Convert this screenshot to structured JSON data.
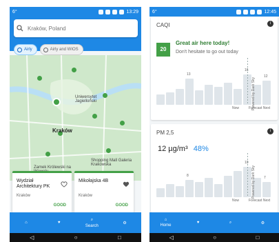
{
  "phone1": {
    "status": {
      "left": "6°",
      "time": "13:29"
    },
    "search": {
      "placeholder": "Kraków, Poland"
    },
    "toggles": [
      {
        "label": "Airly"
      },
      {
        "label": "Airly and WIOS"
      }
    ],
    "map_labels": [
      {
        "text": "Kraków"
      },
      {
        "text": "Uniwersytet Jagielloński"
      },
      {
        "text": "Zamek Królewski na Wawelu"
      },
      {
        "text": "Shopping Mall Galeria Krakowska"
      }
    ],
    "cards": [
      {
        "title": "Wydział Architektury PK",
        "subtitle": "Kraków",
        "level": "GOOD"
      },
      {
        "title": "Mikołajska 4B",
        "subtitle": "Kraków",
        "level": "GOOD"
      }
    ],
    "nav": {
      "home": "",
      "favorites": "",
      "search": "Search",
      "settings": ""
    }
  },
  "phone2": {
    "status": {
      "left": "6°",
      "time": "12:45"
    },
    "caqi": {
      "title": "CAQI",
      "badge": "20",
      "headline": "Great air here today!",
      "subline": "Don't hesitate to go out today",
      "bars": [
        {
          "value": 5
        },
        {
          "value": 6
        },
        {
          "value": 8
        },
        {
          "value": 13
        },
        {
          "value": 7
        },
        {
          "value": 10
        },
        {
          "value": 9
        },
        {
          "value": 11
        },
        {
          "value": 8
        },
        {
          "value": 15
        },
        {
          "value": 10
        },
        {
          "value": 12
        }
      ],
      "bar_labels": [
        "13",
        "16",
        "12"
      ],
      "now_label": "Now",
      "forecast_label": "Forecast Next",
      "powered": "Powered by Dark Sky"
    },
    "pm": {
      "title": "PM 2,5",
      "value": "12 µg/m³",
      "percent": "48%",
      "bars": [
        {
          "value": 4
        },
        {
          "value": 6
        },
        {
          "value": 5
        },
        {
          "value": 8
        },
        {
          "value": 7
        },
        {
          "value": 9
        },
        {
          "value": 6
        },
        {
          "value": 10
        },
        {
          "value": 12
        },
        {
          "value": 14
        },
        {
          "value": 9
        },
        {
          "value": 7
        }
      ],
      "bar_labels": [
        "8",
        "10",
        "7"
      ],
      "now_label": "Now",
      "forecast_label": "Forecast Next",
      "powered": "Powered by Dark Sky"
    },
    "nav": {
      "home": "Home",
      "favorites": "",
      "search": "",
      "settings": ""
    }
  },
  "colors": {
    "brand": "#1e88e5",
    "good": "#43a047"
  }
}
